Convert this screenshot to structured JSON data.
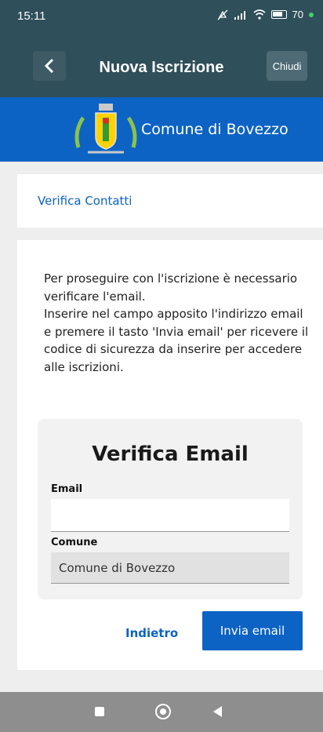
{
  "status": {
    "time": "15:11",
    "battery": "70"
  },
  "appbar": {
    "title": "Nuova Iscrizione",
    "close_label": "Chiudi"
  },
  "banner": {
    "comune": "Comune di Bovezzo"
  },
  "section": {
    "label": "Verifica Contatti"
  },
  "intro": {
    "line1": "Per proseguire con l'iscrizione è necessario verificare l'email.",
    "line2": "Inserire nel campo apposito l'indirizzo email e premere il tasto 'Invia email' per ricevere il codice di sicurezza da inserire per accedere alle iscrizioni."
  },
  "form": {
    "heading": "Verifica Email",
    "email_label": "Email",
    "email_value": "",
    "comune_label": "Comune",
    "comune_value": "Comune di Bovezzo"
  },
  "actions": {
    "back_label": "Indietro",
    "send_label": "Invia email"
  },
  "colors": {
    "header": "#2f4f5a",
    "brand": "#0c63c4"
  },
  "icons": [
    "chevron-left-icon",
    "mute-icon",
    "signal-icon",
    "wifi-icon",
    "battery-icon",
    "crest-icon",
    "nav-recents-icon",
    "nav-home-icon",
    "nav-back-icon"
  ]
}
